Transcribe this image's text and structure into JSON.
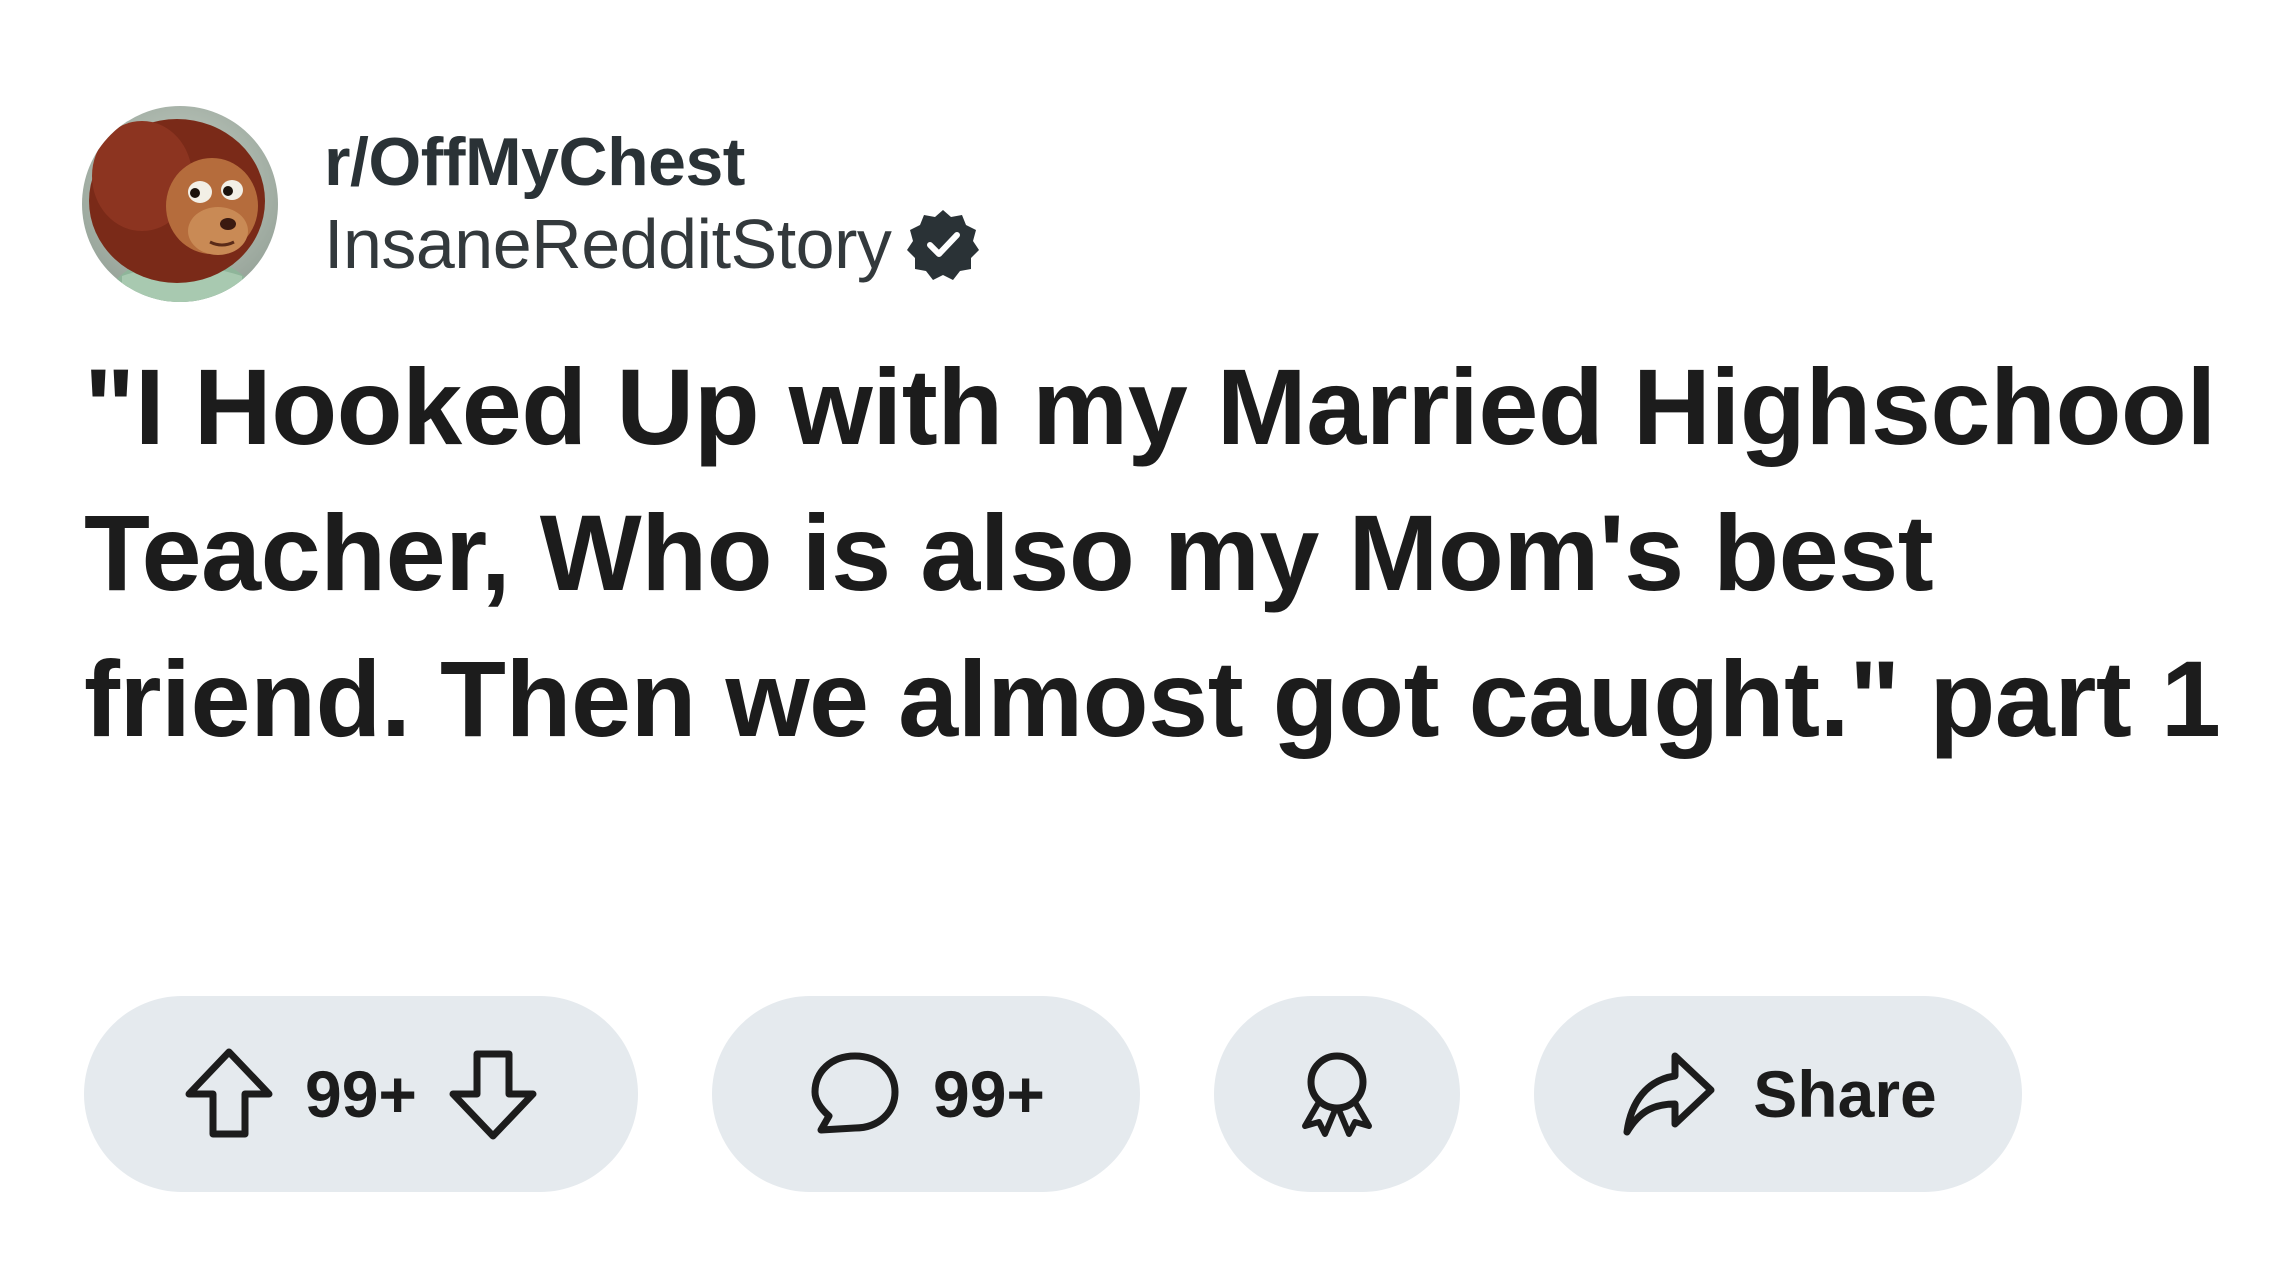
{
  "post": {
    "subreddit": "r/OffMyChest",
    "author": "InsaneRedditStory",
    "verified": true,
    "title": "\"I Hooked Up with my Married Highschool Teacher, Who is also my Mom's best friend. Then we almost got caught.\" part 1"
  },
  "actions": {
    "upvote_icon": "arrow-up-icon",
    "vote_count": "99+",
    "downvote_icon": "arrow-down-icon",
    "comment_icon": "speech-bubble-icon",
    "comment_count": "99+",
    "award_icon": "award-ribbon-icon",
    "share_icon": "share-arrow-icon",
    "share_label": "Share"
  },
  "colors": {
    "pill_background": "#e5eaee",
    "text": "#1c1c1c",
    "verified_badge": "#2a3236"
  }
}
